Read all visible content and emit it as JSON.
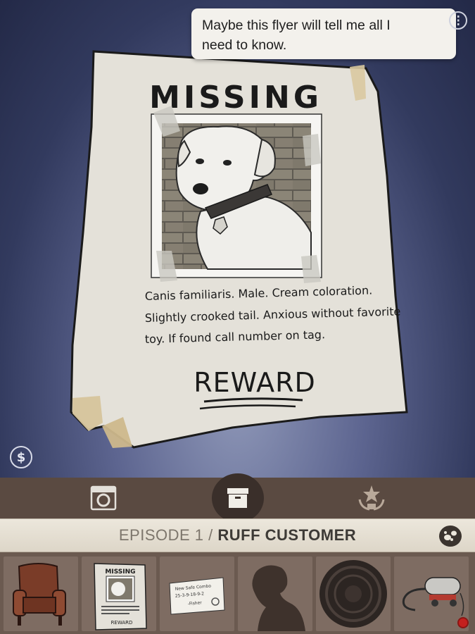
{
  "dialogue": {
    "line1": "Maybe this flyer will tell me all I",
    "line2": "need to know."
  },
  "poster": {
    "title": "MISSING",
    "desc_line1": "Canis familiaris. Male. Cream coloration.",
    "desc_line2": "Slightly crooked tail. Anxious without favorite",
    "desc_line3": "toy. If found call number on tag.",
    "reward": "REWARD"
  },
  "money_icon": "dollar-icon",
  "money_symbol": "$",
  "toolbar": {
    "tools": [
      "camera-icon",
      "evidence-box-icon",
      "trophy-icon"
    ],
    "active_tool": "evidence-box-icon"
  },
  "episode": {
    "number": "EPISODE 1 /",
    "name": "RUFF CUSTOMER"
  },
  "gallery_icon": "paw-prints-icon",
  "inventory": {
    "items": [
      "armchair",
      "missing-poster",
      "safe-combo-note",
      "dog-silhouette",
      "safe-dial",
      "vacuum-cleaner"
    ],
    "note_line1": "New Safe Combo",
    "note_line2": "25-3-9-18-9-2",
    "note_line3": "-Fisher",
    "mini_poster_title": "MISSING",
    "mini_poster_reward": "REWARD"
  },
  "colors": {
    "background": "#323a5e",
    "toolbar": "#5a4a41",
    "episode_bar": "#ece7dc",
    "inventory": "#6b5a50",
    "alert_dot": "#c4201e"
  }
}
